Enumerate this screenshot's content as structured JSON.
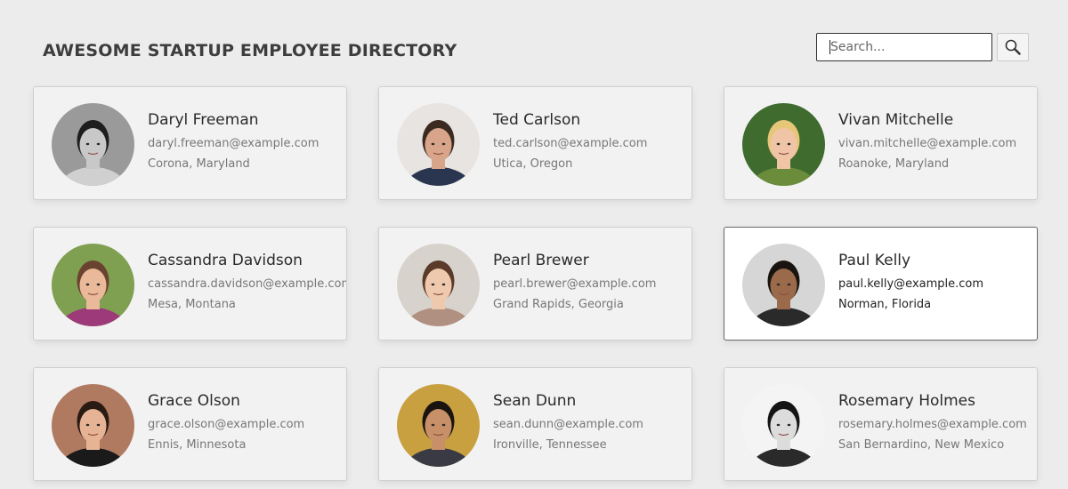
{
  "page": {
    "title": "AWESOME STARTUP EMPLOYEE DIRECTORY"
  },
  "search": {
    "placeholder": "Search...",
    "value": "",
    "button_icon": "search-icon"
  },
  "colors": {
    "background": "#ececec",
    "card_background": "#f2f2f2",
    "card_active_background": "#ffffff",
    "text_primary": "#2a2a2a",
    "text_secondary": "#777777"
  },
  "employees": [
    {
      "name": "Daryl Freeman",
      "email": "daryl.freeman@example.com",
      "location": "Corona, Maryland",
      "selected": false,
      "avatar": {
        "bg": "#9a9a9a",
        "skin": "#c8c8c8",
        "hair": "#1e1e1e",
        "shirt": "#d0d0d0"
      }
    },
    {
      "name": "Ted Carlson",
      "email": "ted.carlson@example.com",
      "location": "Utica, Oregon",
      "selected": false,
      "avatar": {
        "bg": "#e8e4e2",
        "skin": "#d9a58a",
        "hair": "#3a2a20",
        "shirt": "#2a3550"
      }
    },
    {
      "name": "Vivan Mitchelle",
      "email": "vivan.mitchelle@example.com",
      "location": "Roanoke, Maryland",
      "selected": false,
      "avatar": {
        "bg": "#3f6b2e",
        "skin": "#f0c4a6",
        "hair": "#e6c678",
        "shirt": "#6b8c3a"
      }
    },
    {
      "name": "Cassandra Davidson",
      "email": "cassandra.davidson@example.com",
      "location": "Mesa, Montana",
      "selected": false,
      "avatar": {
        "bg": "#7fa050",
        "skin": "#e9b99a",
        "hair": "#6a4230",
        "shirt": "#9c3a7a"
      }
    },
    {
      "name": "Pearl Brewer",
      "email": "pearl.brewer@example.com",
      "location": "Grand Rapids, Georgia",
      "selected": false,
      "avatar": {
        "bg": "#d8d2cc",
        "skin": "#efc9ae",
        "hair": "#5a3a28",
        "shirt": "#b09080"
      }
    },
    {
      "name": "Paul Kelly",
      "email": "paul.kelly@example.com",
      "location": "Norman, Florida",
      "selected": true,
      "avatar": {
        "bg": "#d6d6d6",
        "skin": "#9a6a4a",
        "hair": "#1a1410",
        "shirt": "#2a2a2a"
      }
    },
    {
      "name": "Grace Olson",
      "email": "grace.olson@example.com",
      "location": "Ennis, Minnesota",
      "selected": false,
      "avatar": {
        "bg": "#b07a60",
        "skin": "#e6b494",
        "hair": "#2a1a14",
        "shirt": "#1a1a1a"
      }
    },
    {
      "name": "Sean Dunn",
      "email": "sean.dunn@example.com",
      "location": "Ironville, Tennessee",
      "selected": false,
      "avatar": {
        "bg": "#c8a040",
        "skin": "#c89068",
        "hair": "#1a1410",
        "shirt": "#3a3a44"
      }
    },
    {
      "name": "Rosemary Holmes",
      "email": "rosemary.holmes@example.com",
      "location": "San Bernardino, New Mexico",
      "selected": false,
      "avatar": {
        "bg": "#f4f4f4",
        "skin": "#dcdcdc",
        "hair": "#141414",
        "shirt": "#2a2a2a"
      }
    }
  ]
}
